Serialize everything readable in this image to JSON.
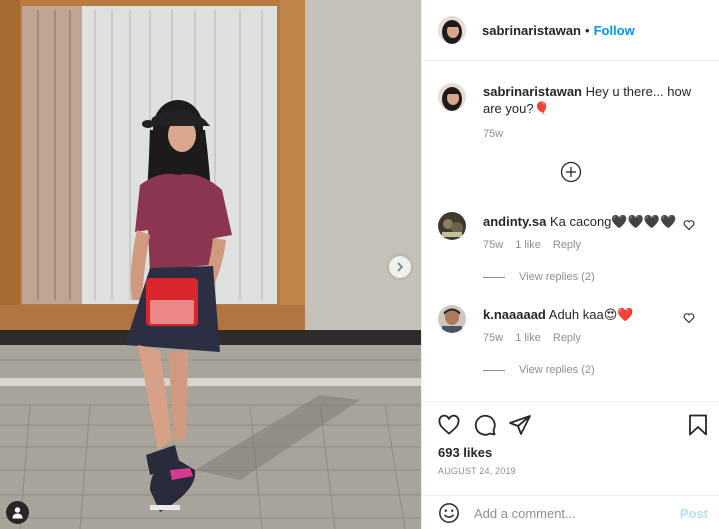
{
  "post": {
    "author": "sabrinaristawan",
    "follow_label": "Follow",
    "dot": "•"
  },
  "caption": {
    "username": "sabrinaristawan",
    "text": "Hey u there... how are you?🎈",
    "time": "75w"
  },
  "comments": [
    {
      "username": "andinty.sa",
      "text": "Ka cacong🖤🖤🖤🖤",
      "time": "75w",
      "likes": "1 like",
      "reply_label": "Reply",
      "view_replies": "View replies (2)"
    },
    {
      "username": "k.naaaaad",
      "text": "Aduh kaa😍❤️",
      "time": "75w",
      "likes": "1 like",
      "reply_label": "Reply",
      "view_replies": "View replies (2)"
    }
  ],
  "footer": {
    "likes": "693 likes",
    "date": "AUGUST 24, 2019"
  },
  "add_comment": {
    "placeholder": "Add a comment...",
    "post_label": "Post"
  },
  "colors": {
    "follow_blue": "#0095f6",
    "post_disabled": "#b2dffc",
    "secondary_text": "#8e8e8e",
    "divider": "#efefef"
  },
  "icons": [
    "chevron-right-icon",
    "user-tag-icon",
    "plus-circle-icon",
    "heart-icon",
    "comment-icon",
    "share-icon",
    "bookmark-icon",
    "emoji-icon"
  ]
}
